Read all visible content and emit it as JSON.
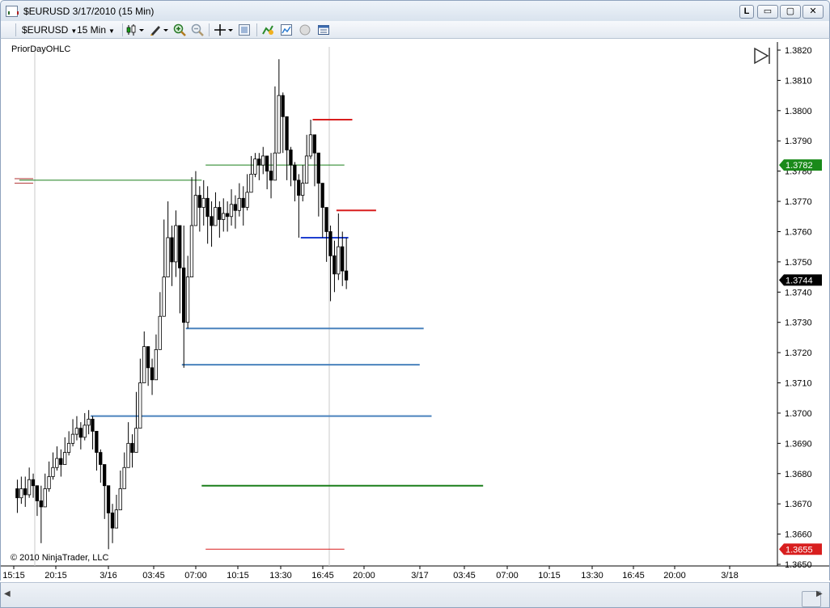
{
  "window": {
    "title": "$EURUSD  3/17/2010 (15 Min)",
    "buttons": {
      "l": "L",
      "minimize": "▭",
      "maximize": "▢",
      "close": "✕"
    }
  },
  "toolbar": {
    "instrument": "$EURUSD",
    "interval": "15 Min",
    "icons": [
      "candlestick-icon",
      "pencil-icon",
      "zoom-in-icon",
      "zoom-out-icon",
      "crosshair-icon",
      "properties-icon",
      "strategy-icon",
      "indicator-icon",
      "circle-icon",
      "data-box-icon"
    ]
  },
  "chart": {
    "indicator_label": "PriorDayOHLC",
    "copyright": "© 2010 NinjaTrader, LLC",
    "scroll_end_icon": "scroll-to-end-icon"
  },
  "colors": {
    "up_candle": "#ffffff",
    "down_candle": "#000000",
    "green_line": "#1a7f1a",
    "red_line": "#d81e1e",
    "blue_line": "#1f3fd0",
    "steel_line": "#4a82bd",
    "last_price_bg": "#000000",
    "green_marker_bg": "#1a8a1a",
    "red_marker_bg": "#d81e1e"
  },
  "chart_data": {
    "type": "candlestick",
    "y_ticks": [
      "1.3820",
      "1.3810",
      "1.3800",
      "1.3790",
      "1.3780",
      "1.3770",
      "1.3760",
      "1.3750",
      "1.3740",
      "1.3730",
      "1.3720",
      "1.3710",
      "1.3700",
      "1.3690",
      "1.3680",
      "1.3670",
      "1.3660",
      "1.3650"
    ],
    "ylim": [
      1.365,
      1.382
    ],
    "x_ticks": [
      "15:15",
      "20:15",
      "3/16",
      "03:45",
      "07:00",
      "10:15",
      "13:30",
      "16:45",
      "20:00",
      "3/17",
      "03:45",
      "07:00",
      "10:15",
      "13:30",
      "16:45",
      "20:00",
      "3/18"
    ],
    "markers": [
      {
        "label": "1.3782",
        "value": 1.3782,
        "color": "green"
      },
      {
        "label": "1.3744",
        "value": 1.3744,
        "color": "black"
      },
      {
        "label": "1.3655",
        "value": 1.3655,
        "color": "red"
      }
    ],
    "levels": [
      {
        "value": 1.3777,
        "from_bar": 1,
        "to_bar": 47,
        "color": "green",
        "width": 1
      },
      {
        "value": 1.3782,
        "from_bar": 48,
        "to_bar": 83,
        "color": "green",
        "width": 1
      },
      {
        "value": 1.3797,
        "from_bar": 75,
        "to_bar": 85,
        "color": "red",
        "width": 2
      },
      {
        "value": 1.3767,
        "from_bar": 81,
        "to_bar": 91,
        "color": "red",
        "width": 2
      },
      {
        "value": 1.3758,
        "from_bar": 72,
        "to_bar": 84,
        "color": "blue",
        "width": 2
      },
      {
        "value": 1.3728,
        "from_bar": 43,
        "to_bar": 103,
        "color": "steel",
        "width": 2
      },
      {
        "value": 1.3716,
        "from_bar": 42,
        "to_bar": 102,
        "color": "steel",
        "width": 2
      },
      {
        "value": 1.3699,
        "from_bar": 19,
        "to_bar": 105,
        "color": "steel",
        "width": 2
      },
      {
        "value": 1.3676,
        "from_bar": 47,
        "to_bar": 118,
        "color": "green",
        "width": 2
      },
      {
        "value": 1.3655,
        "from_bar": 48,
        "to_bar": 83,
        "color": "red",
        "width": 1
      }
    ],
    "close": [
      1.3672,
      1.3675,
      1.3673,
      1.3678,
      1.3676,
      1.3671,
      1.3669,
      1.3675,
      1.3679,
      1.3682,
      1.3685,
      1.3683,
      1.3687,
      1.369,
      1.3693,
      1.3695,
      1.3692,
      1.3696,
      1.3698,
      1.3694,
      1.3687,
      1.3683,
      1.3676,
      1.3667,
      1.3662,
      1.3668,
      1.3675,
      1.3682,
      1.369,
      1.3687,
      1.3695,
      1.371,
      1.3722,
      1.3715,
      1.3711,
      1.3721,
      1.3732,
      1.3745,
      1.3758,
      1.375,
      1.3762,
      1.3748,
      1.373,
      1.3745,
      1.3762,
      1.3772,
      1.3768,
      1.3771,
      1.3765,
      1.3762,
      1.3768,
      1.3764,
      1.3766,
      1.3765,
      1.3769,
      1.3767,
      1.3771,
      1.3768,
      1.3773,
      1.3779,
      1.3784,
      1.3782,
      1.3785,
      1.378,
      1.3777,
      1.3786,
      1.3805,
      1.3798,
      1.3787,
      1.3782,
      1.3777,
      1.3772,
      1.3776,
      1.3785,
      1.3792,
      1.3786,
      1.3776,
      1.3768,
      1.376,
      1.3752,
      1.3746,
      1.3755,
      1.3747,
      1.3744
    ],
    "highs": [
      1.3678,
      1.3679,
      1.3679,
      1.3682,
      1.368,
      1.3676,
      1.3676,
      1.368,
      1.3684,
      1.3687,
      1.3689,
      1.3688,
      1.3692,
      1.3694,
      1.3698,
      1.3699,
      1.3697,
      1.37,
      1.3701,
      1.3699,
      1.3693,
      1.3688,
      1.368,
      1.3671,
      1.367,
      1.3673,
      1.3681,
      1.3687,
      1.3697,
      1.3693,
      1.3707,
      1.3718,
      1.3727,
      1.3722,
      1.3718,
      1.3726,
      1.374,
      1.3764,
      1.377,
      1.3762,
      1.3767,
      1.3762,
      1.3762,
      1.3752,
      1.3778,
      1.378,
      1.3775,
      1.3777,
      1.3775,
      1.377,
      1.3773,
      1.377,
      1.3771,
      1.377,
      1.3774,
      1.3772,
      1.3776,
      1.3775,
      1.3779,
      1.3785,
      1.3786,
      1.3786,
      1.3788,
      1.3785,
      1.3786,
      1.3808,
      1.3817,
      1.3806,
      1.3796,
      1.3788,
      1.3783,
      1.3779,
      1.3782,
      1.3792,
      1.3797,
      1.3792,
      1.3785,
      1.3776,
      1.3768,
      1.3762,
      1.3757,
      1.3766,
      1.376,
      1.3758
    ],
    "lows": [
      1.3667,
      1.367,
      1.3669,
      1.3672,
      1.3672,
      1.3666,
      1.3657,
      1.367,
      1.3674,
      1.3678,
      1.3681,
      1.3679,
      1.3683,
      1.3686,
      1.3689,
      1.3691,
      1.3688,
      1.3691,
      1.3693,
      1.3688,
      1.3681,
      1.3677,
      1.3665,
      1.3655,
      1.3657,
      1.3662,
      1.367,
      1.3677,
      1.3685,
      1.3682,
      1.3689,
      1.3705,
      1.3712,
      1.3709,
      1.3706,
      1.3713,
      1.3726,
      1.3738,
      1.3745,
      1.3742,
      1.3745,
      1.3733,
      1.3715,
      1.3728,
      1.3745,
      1.3762,
      1.376,
      1.3762,
      1.3756,
      1.3755,
      1.3762,
      1.3758,
      1.376,
      1.376,
      1.3762,
      1.3761,
      1.3765,
      1.3762,
      1.3767,
      1.3773,
      1.3778,
      1.3777,
      1.3779,
      1.3774,
      1.3771,
      1.3779,
      1.3795,
      1.3786,
      1.3777,
      1.3775,
      1.377,
      1.3758,
      1.377,
      1.3777,
      1.3784,
      1.3775,
      1.3765,
      1.3758,
      1.375,
      1.3737,
      1.374,
      1.3744,
      1.3742,
      1.3741
    ]
  }
}
